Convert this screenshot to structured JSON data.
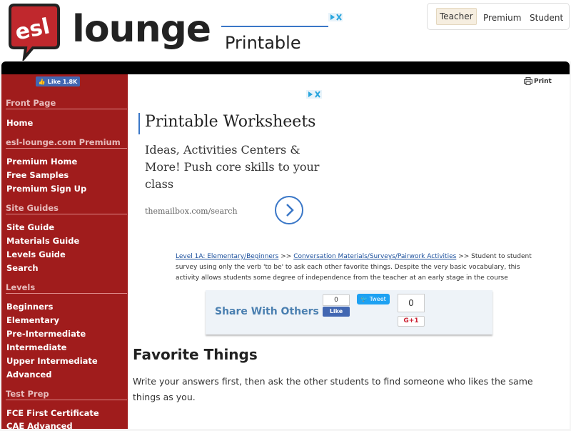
{
  "header": {
    "logo_text": "lounge",
    "logo_badge": "esl",
    "top_ad": {
      "text": "Printable"
    },
    "nav": {
      "tabs": [
        {
          "label": "Teacher"
        },
        {
          "label": "Premium"
        },
        {
          "label": "Student"
        }
      ]
    }
  },
  "sidebar": {
    "fb_like": "Like 1.8K",
    "sections": [
      {
        "title": "Front Page",
        "items": [
          "Home"
        ]
      },
      {
        "title": "esl-lounge.com Premium",
        "items": [
          "Premium Home",
          "Free Samples",
          "Premium Sign Up"
        ]
      },
      {
        "title": "Site Guides",
        "items": [
          "Site Guide",
          "Materials Guide",
          "Levels Guide",
          "Search"
        ]
      },
      {
        "title": "Levels",
        "items": [
          "Beginners",
          "Elementary",
          "Pre-Intermediate",
          "Intermediate",
          "Upper Intermediate",
          "Advanced"
        ]
      },
      {
        "title": "Test Prep",
        "items": [
          "FCE First Certificate",
          "CAE Advanced"
        ]
      }
    ]
  },
  "main": {
    "print_label": "Print",
    "ad": {
      "title": "Printable Worksheets",
      "description": "Ideas, Activities Centers & More! Push core skills to your class",
      "url": "themailbox.com/search"
    },
    "breadcrumb": {
      "link1": "Level 1A: Elementary/Beginners",
      "sep": ">>",
      "link2": "Conversation Materials/Surveys/Pairwork Activities",
      "desc": ">> Student to student survey using only the verb 'to be' to ask each other favorite things. Despite the very basic vocabulary, this activity allows students some degree of independence from the teacher at an early stage in the course"
    },
    "share": {
      "title": "Share With Others",
      "fb_count": "0",
      "fb_label": "Like",
      "tweet_label": "Tweet",
      "tweet_count": "0",
      "gplus_label": "G+1"
    },
    "page_title": "Favorite Things",
    "instructions": "Write your answers first, then ask the other students to find someone who likes the same things as you."
  },
  "colors": {
    "sidebar": "#a01c1c",
    "link": "#1a4f9c",
    "accent_blue": "#3a77c7"
  }
}
